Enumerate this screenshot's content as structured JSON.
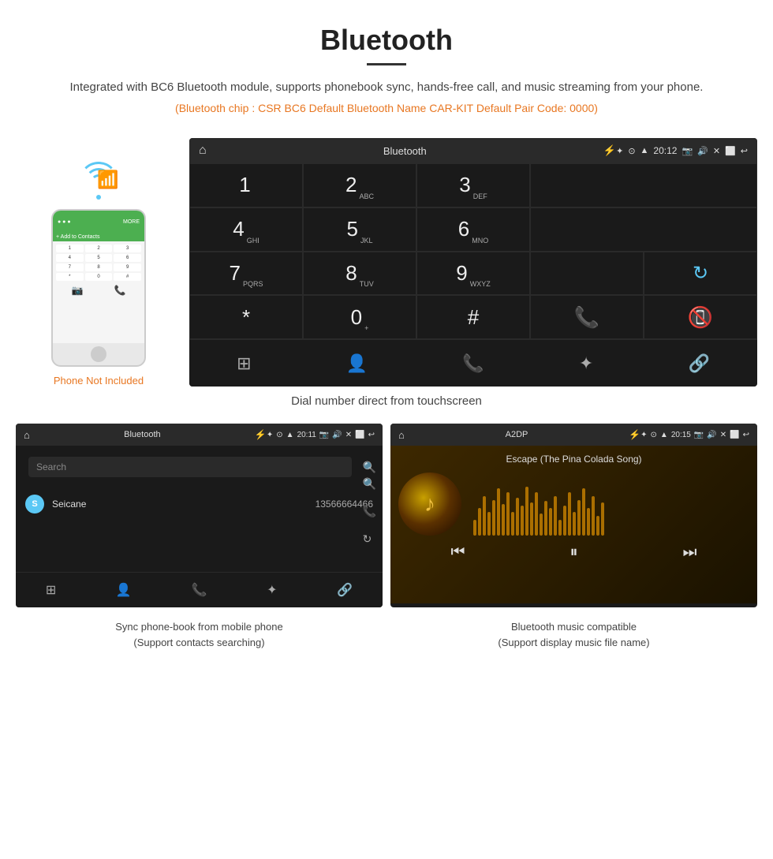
{
  "header": {
    "title": "Bluetooth",
    "description": "Integrated with BC6 Bluetooth module, supports phonebook sync, hands-free call, and music streaming from your phone.",
    "specs": "(Bluetooth chip : CSR BC6    Default Bluetooth Name CAR-KIT    Default Pair Code: 0000)"
  },
  "main_screen": {
    "status_bar": {
      "title": "Bluetooth",
      "time": "20:12"
    },
    "dialpad": {
      "keys": [
        {
          "num": "1",
          "sub": ""
        },
        {
          "num": "2",
          "sub": "ABC"
        },
        {
          "num": "3",
          "sub": "DEF"
        },
        {
          "num": "4",
          "sub": "GHI"
        },
        {
          "num": "5",
          "sub": "JKL"
        },
        {
          "num": "6",
          "sub": "MNO"
        },
        {
          "num": "7",
          "sub": "PQRS"
        },
        {
          "num": "8",
          "sub": "TUV"
        },
        {
          "num": "9",
          "sub": "WXYZ"
        },
        {
          "num": "*",
          "sub": ""
        },
        {
          "num": "0",
          "sub": "+"
        },
        {
          "num": "#",
          "sub": ""
        }
      ]
    }
  },
  "phone": {
    "not_included_text": "Phone Not Included",
    "wifi_color": "#5bc8f5",
    "bt_color": "#5bc8f5"
  },
  "main_caption": "Dial number direct from touchscreen",
  "phonebook_panel": {
    "status_title": "Bluetooth",
    "time": "20:11",
    "search_placeholder": "Search",
    "contacts": [
      {
        "initial": "S",
        "name": "Seicane",
        "number": "13566664466"
      }
    ]
  },
  "music_panel": {
    "status_title": "A2DP",
    "time": "20:15",
    "song_title": "Escape (The Pina Colada Song)"
  },
  "bottom_captions": {
    "phonebook": "Sync phone-book from mobile phone\n(Support contacts searching)",
    "music": "Bluetooth music compatible\n(Support display music file name)"
  }
}
